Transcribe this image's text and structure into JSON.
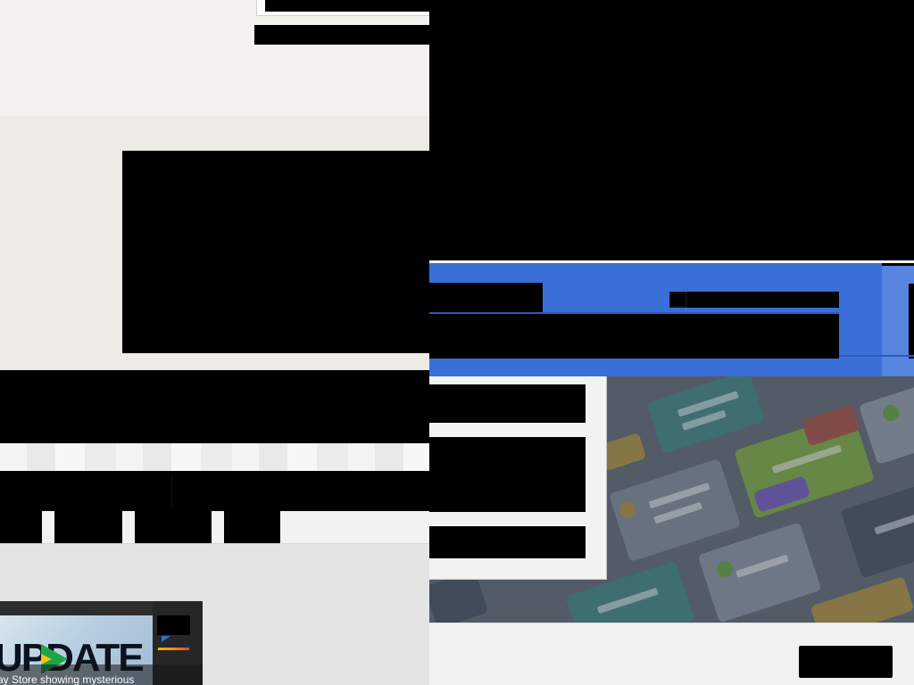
{
  "news_card": {
    "thumbnail_text": "UPDATE",
    "caption": "ay Store showing mysterious"
  },
  "colors": {
    "header_blue": "#3a6fd8",
    "header_blue_light": "#5684de",
    "panel_background": "#f2f2f2",
    "left_background": "#f1f0ec",
    "redacted": "#000000",
    "play_icon_green": "#1ca64a",
    "play_icon_yellow": "#f4c20d"
  },
  "icons": {
    "news_thumbnail": "play-store-icon"
  }
}
